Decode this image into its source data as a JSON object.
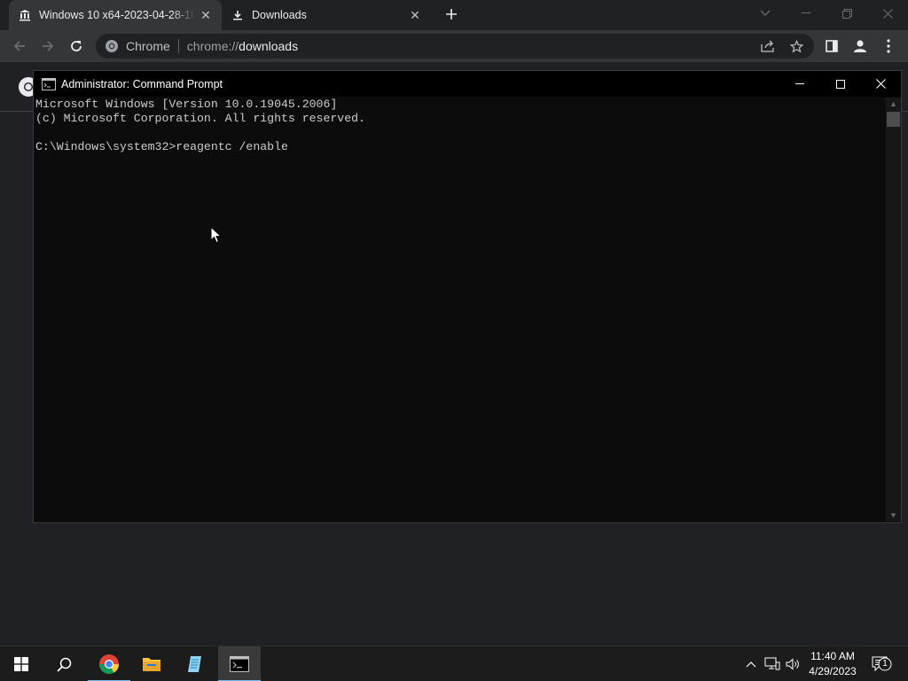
{
  "browser": {
    "tabs": [
      {
        "title": "Windows 10 x64-2023-04-28-18",
        "icon": "bank-icon",
        "active": true
      },
      {
        "title": "Downloads",
        "icon": "download-icon",
        "active": false
      }
    ],
    "omnibox": {
      "site_chip": "Chrome",
      "url_scheme": "chrome://",
      "url_host": "downloads"
    }
  },
  "cmd": {
    "title": "Administrator: Command Prompt",
    "lines": [
      "Microsoft Windows [Version 10.0.19045.2006]",
      "(c) Microsoft Corporation. All rights reserved.",
      "",
      "C:\\Windows\\system32>reagentc /enable"
    ]
  },
  "taskbar": {
    "apps": [
      "start",
      "search",
      "chrome",
      "file-explorer",
      "notepad",
      "command-prompt"
    ],
    "clock_time": "11:40 AM",
    "clock_date": "4/29/2023",
    "notification_count": "1",
    "accent_color": "#76b9ed"
  }
}
